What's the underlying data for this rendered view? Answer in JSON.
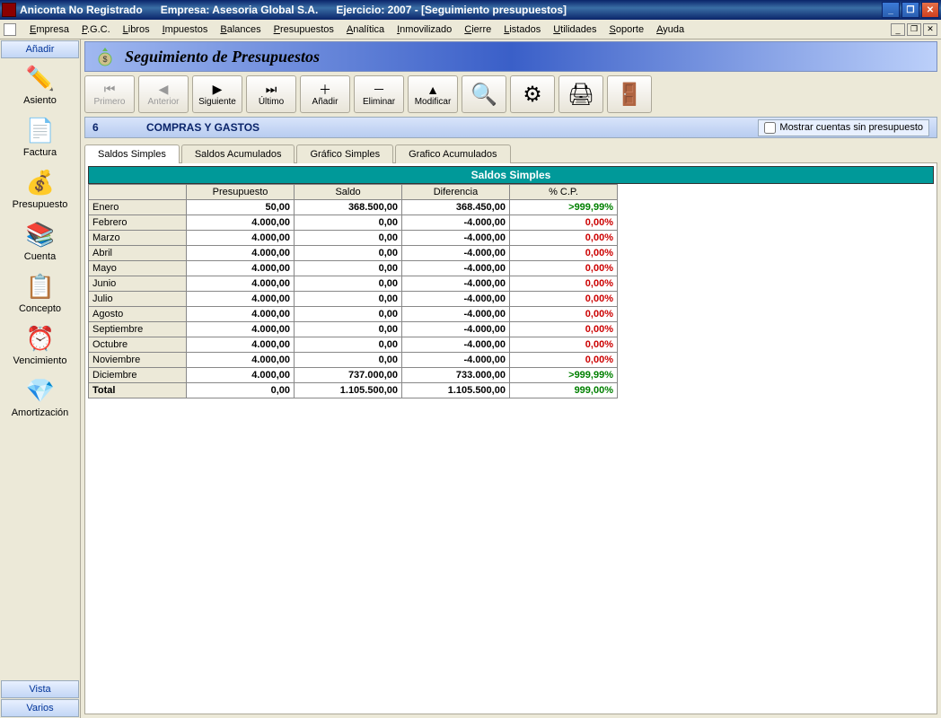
{
  "titlebar": {
    "app": "Aniconta No Registrado",
    "empresa_label": "Empresa: Asesoria Global S.A.",
    "ejercicio_label": "Ejercicio: 2007 - [Seguimiento presupuestos]"
  },
  "menubar": {
    "items": [
      "Empresa",
      "P.G.C.",
      "Libros",
      "Impuestos",
      "Balances",
      "Presupuestos",
      "Analítica",
      "Inmovilizado",
      "Cierre",
      "Listados",
      "Utilidades",
      "Soporte",
      "Ayuda"
    ]
  },
  "sidebar": {
    "header": "Añadir",
    "items": [
      {
        "label": "Asiento"
      },
      {
        "label": "Factura"
      },
      {
        "label": "Presupuesto"
      },
      {
        "label": "Cuenta"
      },
      {
        "label": "Concepto"
      },
      {
        "label": "Vencimiento"
      },
      {
        "label": "Amortización"
      }
    ],
    "footer": [
      "Vista",
      "Varios"
    ]
  },
  "doc": {
    "title": "Seguimiento de Presupuestos"
  },
  "toolbar": {
    "primero": "Primero",
    "anterior": "Anterior",
    "siguiente": "Siguiente",
    "ultimo": "Último",
    "anadir": "Añadir",
    "eliminar": "Eliminar",
    "modificar": "Modificar"
  },
  "subheader": {
    "num": "6",
    "name": "COMPRAS Y GASTOS",
    "checkbox_label": "Mostrar cuentas sin presupuesto"
  },
  "tabs": [
    "Saldos Simples",
    "Saldos Acumulados",
    "Gráfico Simples",
    "Grafico Acumulados"
  ],
  "grid": {
    "title": "Saldos Simples",
    "columns": [
      "",
      "Presupuesto",
      "Saldo",
      "Diferencia",
      "% C.P."
    ],
    "rows": [
      {
        "m": "Enero",
        "p": "50,00",
        "s": "368.500,00",
        "d": "368.450,00",
        "c": ">999,99%",
        "cl": "green"
      },
      {
        "m": "Febrero",
        "p": "4.000,00",
        "s": "0,00",
        "d": "-4.000,00",
        "c": "0,00%",
        "cl": "red"
      },
      {
        "m": "Marzo",
        "p": "4.000,00",
        "s": "0,00",
        "d": "-4.000,00",
        "c": "0,00%",
        "cl": "red"
      },
      {
        "m": "Abril",
        "p": "4.000,00",
        "s": "0,00",
        "d": "-4.000,00",
        "c": "0,00%",
        "cl": "red"
      },
      {
        "m": "Mayo",
        "p": "4.000,00",
        "s": "0,00",
        "d": "-4.000,00",
        "c": "0,00%",
        "cl": "red"
      },
      {
        "m": "Junio",
        "p": "4.000,00",
        "s": "0,00",
        "d": "-4.000,00",
        "c": "0,00%",
        "cl": "red"
      },
      {
        "m": "Julio",
        "p": "4.000,00",
        "s": "0,00",
        "d": "-4.000,00",
        "c": "0,00%",
        "cl": "red"
      },
      {
        "m": "Agosto",
        "p": "4.000,00",
        "s": "0,00",
        "d": "-4.000,00",
        "c": "0,00%",
        "cl": "red"
      },
      {
        "m": "Septiembre",
        "p": "4.000,00",
        "s": "0,00",
        "d": "-4.000,00",
        "c": "0,00%",
        "cl": "red"
      },
      {
        "m": "Octubre",
        "p": "4.000,00",
        "s": "0,00",
        "d": "-4.000,00",
        "c": "0,00%",
        "cl": "red"
      },
      {
        "m": "Noviembre",
        "p": "4.000,00",
        "s": "0,00",
        "d": "-4.000,00",
        "c": "0,00%",
        "cl": "red"
      },
      {
        "m": "Diciembre",
        "p": "4.000,00",
        "s": "737.000,00",
        "d": "733.000,00",
        "c": ">999,99%",
        "cl": "green"
      }
    ],
    "total": {
      "m": "Total",
      "p": "0,00",
      "s": "1.105.500,00",
      "d": "1.105.500,00",
      "c": "999,00%",
      "cl": "green"
    }
  }
}
